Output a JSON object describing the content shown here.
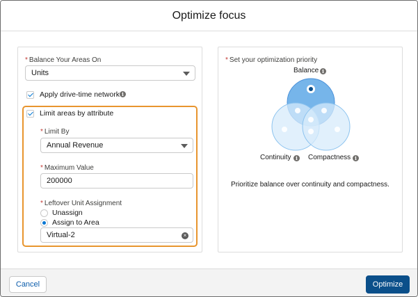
{
  "header": {
    "title": "Optimize focus"
  },
  "left": {
    "balance_label": "Balance Your Areas On",
    "balance_value": "Units",
    "drive_time_label": "Apply drive-time network",
    "limit_areas_label": "Limit areas by attribute",
    "limit_by_label": "Limit By",
    "limit_by_value": "Annual Revenue",
    "max_value_label": "Maximum Value",
    "max_value": "200000",
    "leftover_label": "Leftover Unit Assignment",
    "leftover_options": [
      "Unassign",
      "Assign to Area"
    ],
    "leftover_selected": "Assign to Area",
    "area_value": "Virtual-2",
    "required_mark": "*"
  },
  "right": {
    "priority_label": "Set your optimization priority",
    "venn": {
      "top": "Balance",
      "left": "Continuity",
      "right": "Compactness",
      "selected": "Balance"
    },
    "message": "Prioritize balance over continuity and compactness."
  },
  "footer": {
    "cancel": "Cancel",
    "optimize": "Optimize"
  },
  "colors": {
    "brand": "#0b4f8a",
    "accent": "#0176d3",
    "highlight": "#e8952e",
    "venn_fill": "#d7ebfb",
    "venn_selected": "#5ea8e6"
  },
  "icons": {
    "info": "i",
    "clear": "×"
  }
}
